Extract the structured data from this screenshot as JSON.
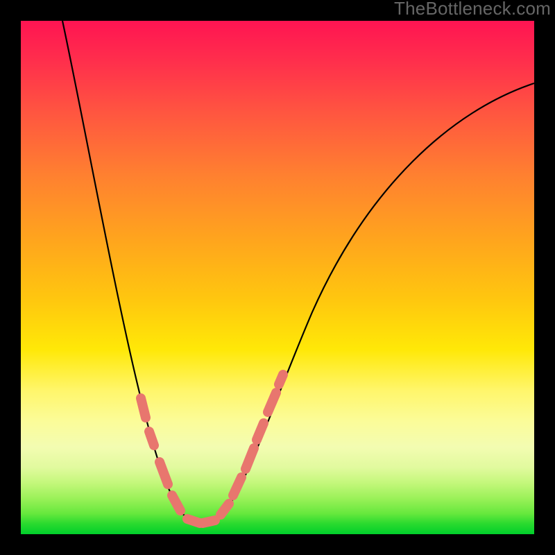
{
  "watermark": "TheBottleneck.com",
  "colors": {
    "background": "#000000",
    "gradient_top": "#ff1452",
    "gradient_mid": "#ffe807",
    "gradient_bottom": "#00cf2b",
    "curve": "#000000",
    "markers": "#e8766e",
    "watermark": "#666666"
  },
  "chart_data": {
    "type": "line",
    "title": "",
    "xlabel": "",
    "ylabel": "",
    "xlim": [
      0,
      100
    ],
    "ylim": [
      0,
      100
    ],
    "note": "Single V-shaped curve over a vertical red-to-green gradient. No axis ticks or labels visible; values estimated from pixel position as percentage of plot area (origin bottom-left).",
    "series": [
      {
        "name": "curve",
        "x": [
          8,
          12,
          18,
          23,
          28,
          30,
          33,
          35,
          38,
          41,
          45,
          50,
          57,
          68,
          84,
          100
        ],
        "y": [
          100,
          81,
          47,
          27,
          12,
          6,
          2,
          1,
          2,
          4,
          11,
          24,
          43,
          65,
          82,
          88
        ]
      }
    ],
    "markers": {
      "name": "highlighted-segments",
      "approx_x_range": [
        23,
        51
      ],
      "approx_y_range": [
        1,
        31
      ],
      "count": 12,
      "color": "#e8766e"
    },
    "background_gradient_axis": "y",
    "background_gradient_stops": [
      {
        "y": 100,
        "color": "#ff1452"
      },
      {
        "y": 50,
        "color": "#ffd400"
      },
      {
        "y": 10,
        "color": "#c4f77b"
      },
      {
        "y": 0,
        "color": "#00cf2b"
      }
    ]
  }
}
